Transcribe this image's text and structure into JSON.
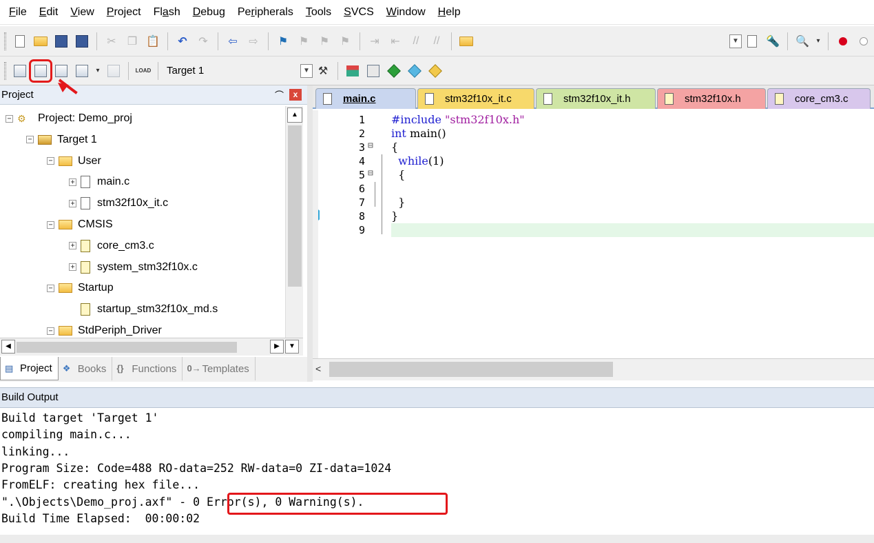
{
  "menu": [
    {
      "label": "File",
      "acc": "F",
      "rest": "ile"
    },
    {
      "label": "Edit",
      "acc": "E",
      "rest": "dit"
    },
    {
      "label": "View",
      "acc": "V",
      "rest": "iew"
    },
    {
      "label": "Project",
      "acc": "P",
      "rest": "roject"
    },
    {
      "label": "Flash",
      "acc": "",
      "pre": "Fl",
      "mid": "a",
      "rest": "sh"
    },
    {
      "label": "Debug",
      "acc": "D",
      "rest": "ebug"
    },
    {
      "label": "Peripherals",
      "acc": "",
      "pre": "Pe",
      "mid": "r",
      "rest": "ipherals"
    },
    {
      "label": "Tools",
      "acc": "T",
      "rest": "ools"
    },
    {
      "label": "SVCS",
      "acc": "S",
      "rest": "VCS"
    },
    {
      "label": "Window",
      "acc": "W",
      "rest": "indow"
    },
    {
      "label": "Help",
      "acc": "H",
      "rest": "elp"
    }
  ],
  "toolbar2": {
    "load_text": "LOAD",
    "target": "Target 1"
  },
  "project_panel": {
    "title": "Project",
    "pin": "⌒",
    "close": "x",
    "tree": [
      {
        "label": "Project: Demo_proj",
        "kind": "project",
        "level": 0,
        "exp": "−"
      },
      {
        "label": "Target 1",
        "kind": "target",
        "level": 1,
        "exp": "−"
      },
      {
        "label": "User",
        "kind": "folder",
        "level": 2,
        "exp": "−"
      },
      {
        "label": "main.c",
        "kind": "file",
        "level": 3,
        "exp": "+"
      },
      {
        "label": "stm32f10x_it.c",
        "kind": "file",
        "level": 3,
        "exp": "+"
      },
      {
        "label": "CMSIS",
        "kind": "folder",
        "level": 2,
        "exp": "−"
      },
      {
        "label": "core_cm3.c",
        "kind": "keyfile",
        "level": 3,
        "exp": "+"
      },
      {
        "label": "system_stm32f10x.c",
        "kind": "keyfile",
        "level": 3,
        "exp": "+"
      },
      {
        "label": "Startup",
        "kind": "folder",
        "level": 2,
        "exp": "−"
      },
      {
        "label": "startup_stm32f10x_md.s",
        "kind": "keyfile",
        "level": 3,
        "exp": ""
      },
      {
        "label": "StdPeriph_Driver",
        "kind": "folder",
        "level": 2,
        "exp": "−"
      }
    ],
    "tabs": [
      {
        "label": "Project",
        "icon": "▤",
        "active": true
      },
      {
        "label": "Books",
        "icon": "❖",
        "active": false
      },
      {
        "label": "Functions",
        "icon": "{}",
        "active": false
      },
      {
        "label": "Templates",
        "icon": "0→",
        "active": false
      }
    ]
  },
  "editor": {
    "tabs": [
      {
        "label": "main.c",
        "color": "#c9d6ef",
        "icon": "doc",
        "active": true
      },
      {
        "label": "stm32f10x_it.c",
        "color": "#f7d96b",
        "icon": "doc",
        "active": false
      },
      {
        "label": "stm32f10x_it.h",
        "color": "#cfe5a4",
        "icon": "doc",
        "active": false
      },
      {
        "label": "stm32f10x.h",
        "color": "#f4a3a3",
        "icon": "key",
        "active": false
      },
      {
        "label": "core_cm3.c",
        "color": "#d8c7ec",
        "icon": "key",
        "active": false
      }
    ],
    "line_numbers": [
      "1",
      "2",
      "3",
      "4",
      "5",
      "6",
      "7",
      "8",
      "9"
    ],
    "code": [
      {
        "parts": [
          {
            "t": "#include ",
            "c": "pp"
          },
          {
            "t": "\"stm32f10x.h\"",
            "c": "str"
          }
        ]
      },
      {
        "parts": [
          {
            "t": "int",
            "c": "kw"
          },
          {
            "t": " main()",
            "c": ""
          }
        ]
      },
      {
        "parts": [
          {
            "t": "{",
            "c": ""
          }
        ]
      },
      {
        "parts": [
          {
            "t": "  ",
            "c": ""
          },
          {
            "t": "while",
            "c": "kw"
          },
          {
            "t": "(1)",
            "c": ""
          }
        ]
      },
      {
        "parts": [
          {
            "t": "  {",
            "c": ""
          }
        ]
      },
      {
        "parts": [
          {
            "t": "",
            "c": ""
          }
        ]
      },
      {
        "parts": [
          {
            "t": "  }",
            "c": ""
          }
        ]
      },
      {
        "parts": [
          {
            "t": "}",
            "c": ""
          }
        ]
      },
      {
        "parts": [
          {
            "t": "",
            "c": ""
          }
        ]
      }
    ],
    "scroll_left": "<"
  },
  "build_output": {
    "title": "Build Output",
    "lines": [
      "Build target 'Target 1'",
      "compiling main.c...",
      "linking...",
      "Program Size: Code=488 RO-data=252 RW-data=0 ZI-data=1024",
      "FromELF: creating hex file...",
      "\".\\Objects\\Demo_proj.axf\" - 0 Error(s), 0 Warning(s).",
      "Build Time Elapsed:  00:00:02"
    ]
  },
  "colors": {
    "highlight": "#e3171b",
    "keyword": "#1d1dd0",
    "string": "#a01ea0",
    "current_line": "#e4f7e7"
  }
}
